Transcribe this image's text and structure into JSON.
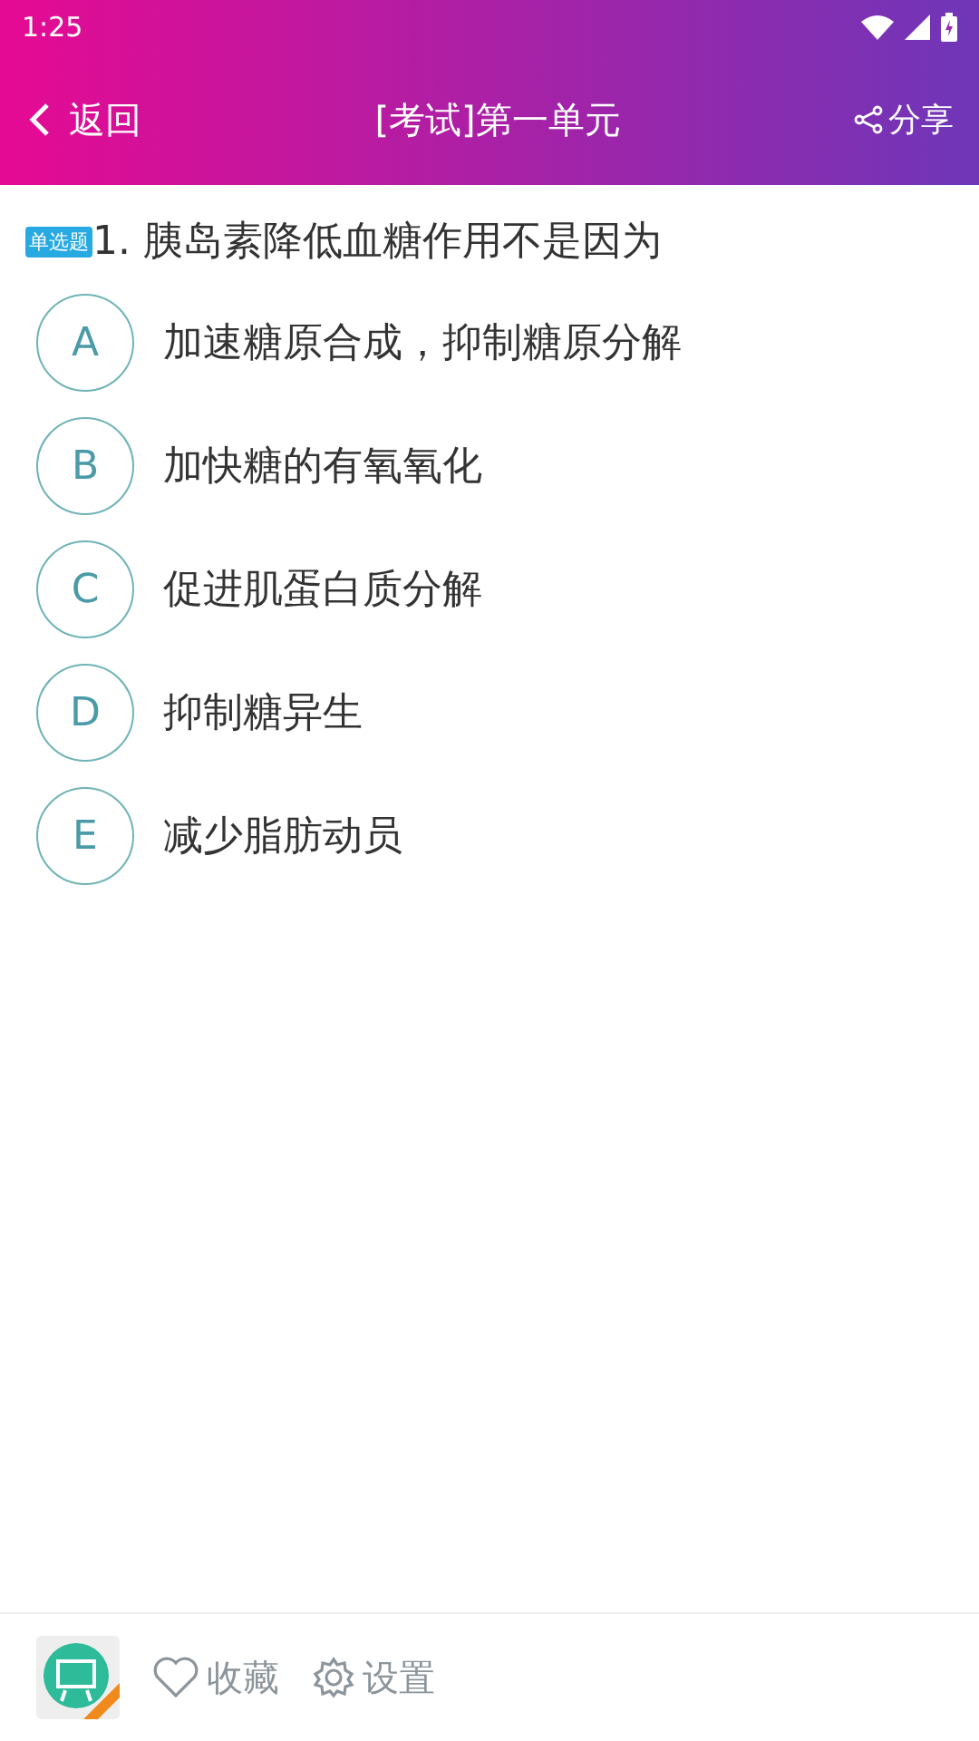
{
  "status_bar": {
    "time": "1:25"
  },
  "header": {
    "back": "返回",
    "title": "[考试]第一单元",
    "share": "分享"
  },
  "question": {
    "type_badge": "单选题",
    "text": "1. 胰岛素降低血糖作用不是因为"
  },
  "options": [
    {
      "letter": "A",
      "text": "加速糖原合成，抑制糖原分解"
    },
    {
      "letter": "B",
      "text": "加快糖的有氧氧化"
    },
    {
      "letter": "C",
      "text": "促进肌蛋白质分解"
    },
    {
      "letter": "D",
      "text": "抑制糖异生"
    },
    {
      "letter": "E",
      "text": "减少脂肪动员"
    }
  ],
  "bottom_bar": {
    "favorite": "收藏",
    "settings": "设置"
  }
}
